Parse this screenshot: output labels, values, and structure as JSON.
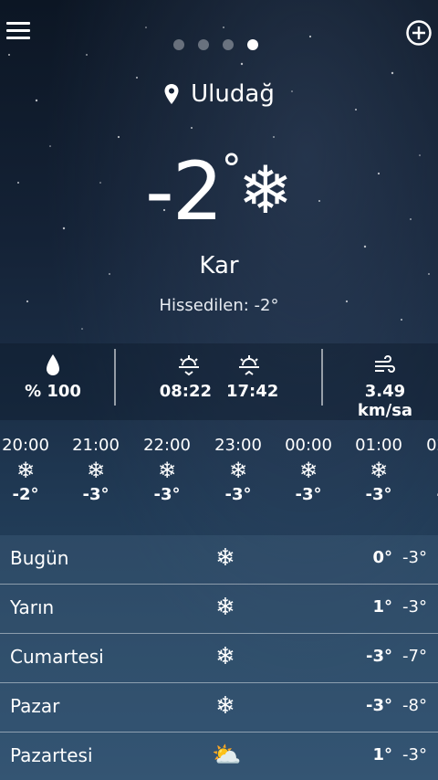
{
  "header": {
    "menu_icon": "hamburger-menu-icon",
    "add_icon": "add-circle-icon",
    "page_count": 4,
    "active_page": 4
  },
  "location": {
    "city": "Uludağ",
    "icon": "location-pin-icon"
  },
  "current": {
    "temp": "-2",
    "degree_symbol": "°",
    "condition_icon": "❄",
    "condition": "Kar",
    "feels_like": "Hissedilen: -2°"
  },
  "stats": {
    "humidity": "% 100",
    "sunrise": "08:22",
    "sunset": "17:42",
    "wind": "3.49 km/sa"
  },
  "hourly": [
    {
      "time": "20:00",
      "icon": "❄",
      "temp": "-2°"
    },
    {
      "time": "21:00",
      "icon": "❄",
      "temp": "-3°"
    },
    {
      "time": "22:00",
      "icon": "❄",
      "temp": "-3°"
    },
    {
      "time": "23:00",
      "icon": "❄",
      "temp": "-3°"
    },
    {
      "time": "00:00",
      "icon": "❄",
      "temp": "-3°"
    },
    {
      "time": "01:00",
      "icon": "❄",
      "temp": "-3°"
    },
    {
      "time": "02:00",
      "icon": "❄",
      "temp": "-3°"
    }
  ],
  "daily": [
    {
      "day": "Bugün",
      "icon": "❄",
      "high": "0°",
      "low": "-3°"
    },
    {
      "day": "Yarın",
      "icon": "❄",
      "high": "1°",
      "low": "-3°"
    },
    {
      "day": "Cumartesi",
      "icon": "❄",
      "high": "-3°",
      "low": "-7°"
    },
    {
      "day": "Pazar",
      "icon": "❄",
      "high": "-3°",
      "low": "-8°"
    },
    {
      "day": "Pazartesi",
      "icon": "⛅",
      "high": "1°",
      "low": "-3°"
    }
  ]
}
